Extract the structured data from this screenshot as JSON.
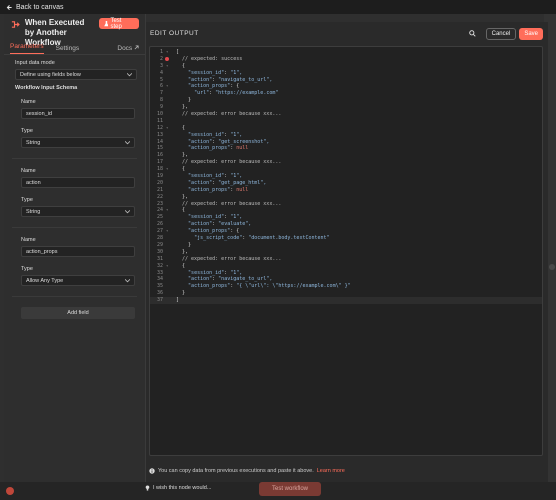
{
  "topbar": {
    "back_label": "Back to canvas"
  },
  "node": {
    "title": "When Executed by Another Workflow",
    "test_step_label": "Test step",
    "tabs": [
      "Parameters",
      "Settings",
      "Docs"
    ]
  },
  "params": {
    "input_mode_label": "Input data mode",
    "input_mode_value": "Define using fields below",
    "schema_label": "Workflow Input Schema",
    "fields": [
      {
        "name_label": "Name",
        "name_value": "session_id",
        "type_label": "Type",
        "type_value": "String"
      },
      {
        "name_label": "Name",
        "name_value": "action",
        "type_label": "Type",
        "type_value": "String"
      },
      {
        "name_label": "Name",
        "name_value": "action_props",
        "type_label": "Type",
        "type_value": "Allow Any Type"
      }
    ],
    "add_field_label": "Add field"
  },
  "editor": {
    "title": "EDIT OUTPUT",
    "cancel_label": "Cancel",
    "save_label": "Save",
    "lines": [
      "[",
      "  // expected: success",
      "  {",
      "    \"session_id\": \"1\",",
      "    \"action\": \"navigate_to_url\",",
      "    \"action_props\": {",
      "      \"url\": \"https://example.com\"",
      "    }",
      "  },",
      "  // expected: error because xxx...",
      "",
      "  {",
      "    \"session_id\": \"1\",",
      "    \"action\": \"get_screenshot\",",
      "    \"action_props\": null",
      "  },",
      "  // expected: error because xxx...",
      "  {",
      "    \"session_id\": \"1\",",
      "    \"action\": \"get_page_html\",",
      "    \"action_props\": null",
      "  },",
      "  // expected: error because xxx...",
      "  {",
      "    \"session_id\": \"1\",",
      "    \"action\": \"evaluate\",",
      "    \"action_props\": {",
      "      \"js_script_code\": \"document.body.textContent\"",
      "    }",
      "  },",
      "  // expected: error because xxx...",
      "  {",
      "    \"session_id\": \"1\",",
      "    \"action\": \"navigate_to_url\",",
      "    \"action_props\": \"{ \\\"url\\\": \\\"https://example.com\\\" }\"",
      "  }",
      "]"
    ],
    "hint_text": "You can copy data from previous executions and paste it above.",
    "hint_link": "Learn more"
  },
  "footer": {
    "wish_text": "I wish this node would...",
    "test_workflow_label": "Test workflow"
  },
  "colors": {
    "accent": "#ff6d5a",
    "background": "#2a2a2a",
    "code_bg": "#222222"
  }
}
